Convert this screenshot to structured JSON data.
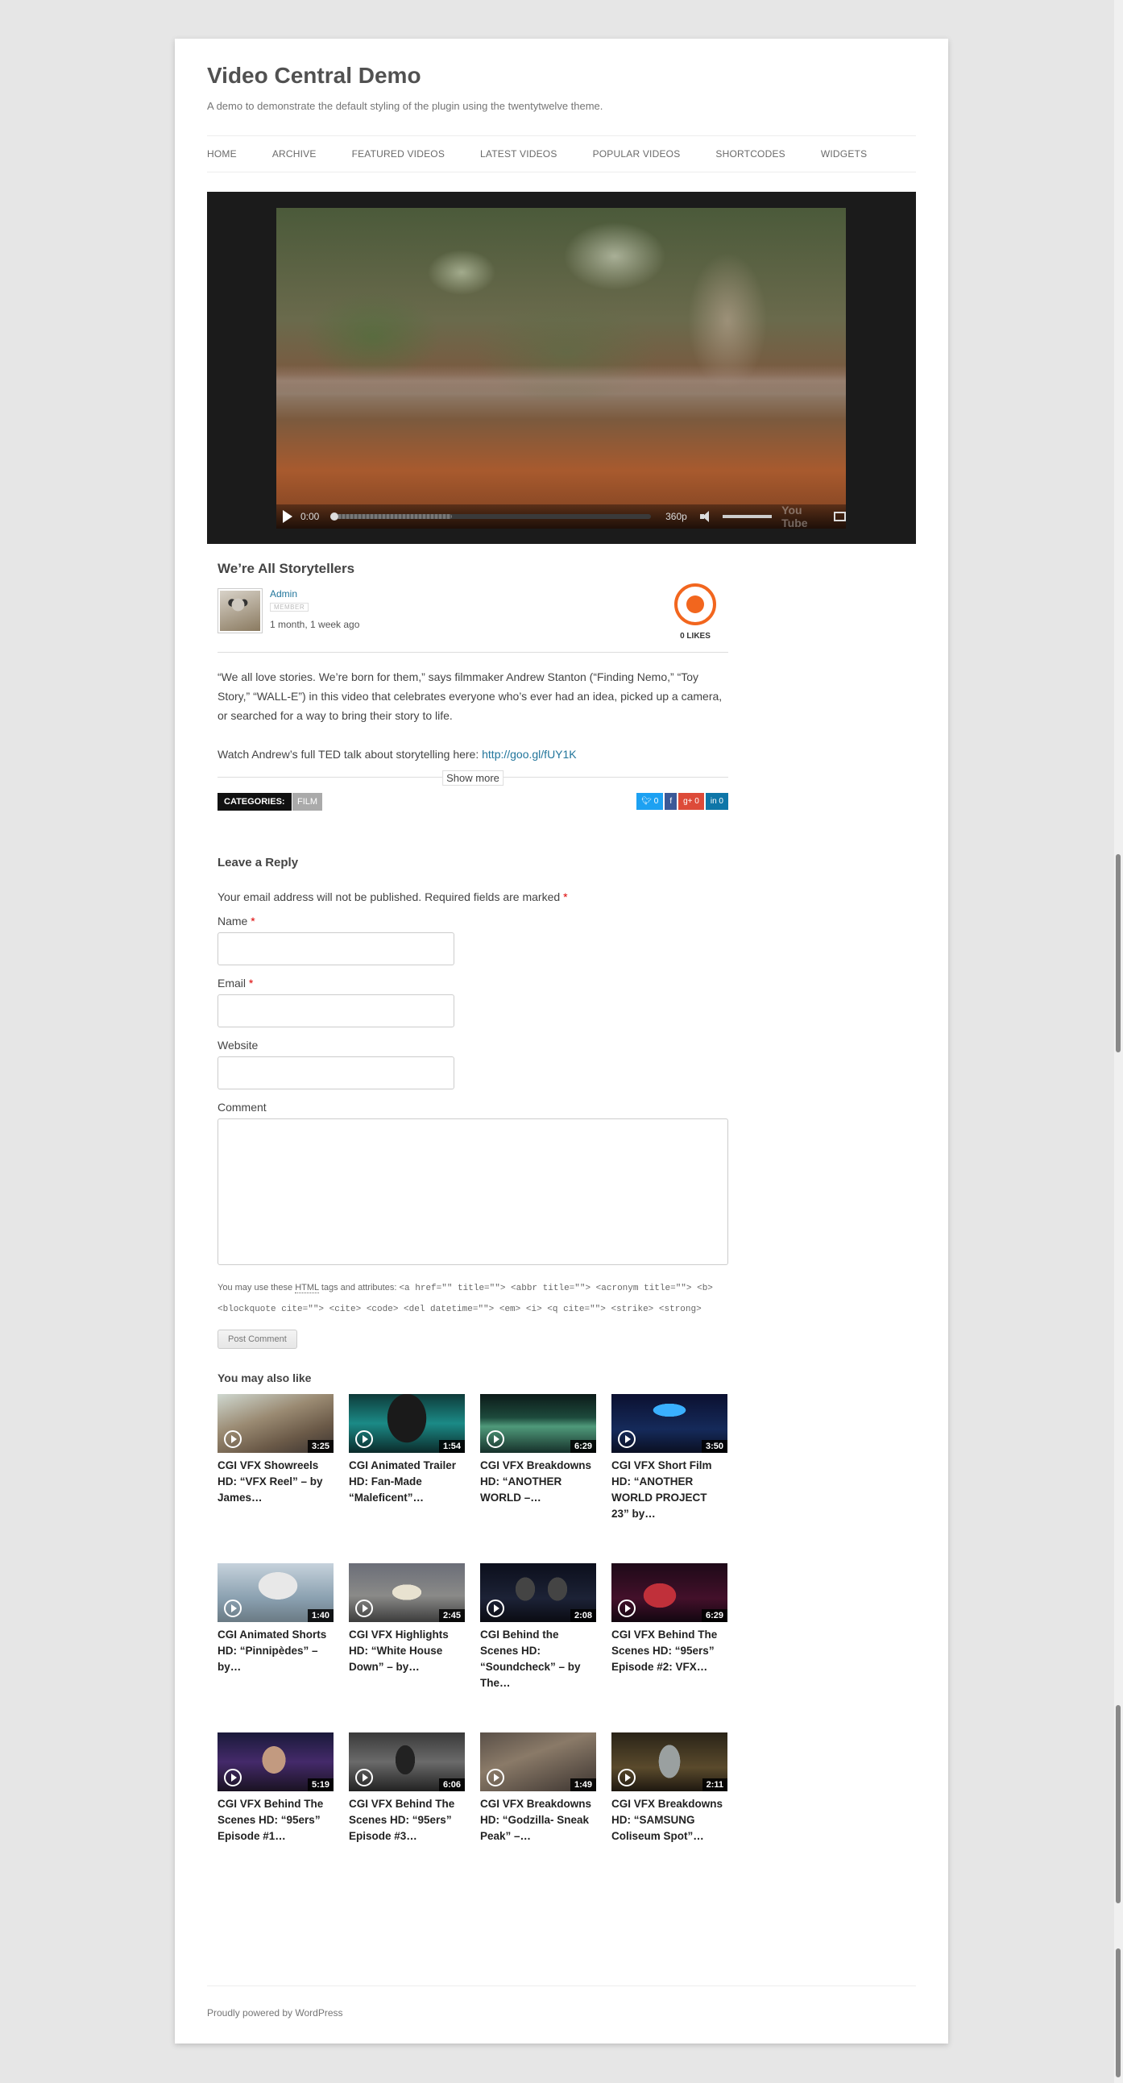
{
  "site": {
    "title": "Video Central Demo",
    "description": "A demo to demonstrate the default styling of the plugin using the twentytwelve theme."
  },
  "nav": {
    "items": [
      "HOME",
      "ARCHIVE",
      "FEATURED VIDEOS",
      "LATEST VIDEOS",
      "POPULAR VIDEOS",
      "SHORTCODES",
      "WIDGETS"
    ]
  },
  "player": {
    "time": "0:00",
    "quality": "360p",
    "watermark": "You Tube"
  },
  "post": {
    "title": "We’re All Storytellers",
    "author": "Admin",
    "author_role": "MEMBER",
    "time_ago": "1 month, 1 week ago",
    "likes": "0 LIKES",
    "paragraph1": "“We all love stories. We’re born for them,” says filmmaker Andrew Stanton (“Finding Nemo,” “Toy Story,” “WALL-E”) in this video that celebrates everyone who’s ever had an idea, picked up a camera, or searched for a way to bring their story to life.",
    "paragraph2_text": "Watch Andrew’s full TED talk about storytelling here: ",
    "paragraph2_link": "http://goo.gl/fUY1K",
    "show_more": "Show more",
    "categories_label": "CATEGORIES:",
    "category": "FILM",
    "share": {
      "twitter": "  0",
      "facebook": "f",
      "google": "g+ 0",
      "linkedin": "in 0"
    }
  },
  "reply": {
    "title": "Leave a Reply",
    "notes": "Your email address will not be published. Required fields are marked ",
    "required_mark": "*",
    "name_label": "Name ",
    "email_label": "Email ",
    "website_label": "Website",
    "comment_label": "Comment",
    "allowed_prefix": "You may use these ",
    "allowed_abbr": "HTML",
    "allowed_middle": " tags and attributes: ",
    "allowed_code": "<a href=\"\" title=\"\"> <abbr title=\"\"> <acronym title=\"\"> <b> <blockquote cite=\"\"> <cite> <code> <del datetime=\"\"> <em> <i> <q cite=\"\"> <strike> <strong>",
    "post_button": "Post Comment"
  },
  "related": {
    "title": "You may also like",
    "items": [
      {
        "title": "CGI VFX Showreels HD: “VFX Reel” – by James…",
        "duration": "3:25"
      },
      {
        "title": "CGI Animated Trailer HD: Fan-Made “Maleficent”…",
        "duration": "1:54"
      },
      {
        "title": "CGI VFX Breakdowns HD: “ANOTHER WORLD –…",
        "duration": "6:29"
      },
      {
        "title": "CGI VFX Short Film HD: “ANOTHER WORLD PROJECT 23” by…",
        "duration": "3:50"
      },
      {
        "title": "CGI Animated Shorts HD: “Pinnipèdes” – by…",
        "duration": "1:40"
      },
      {
        "title": "CGI VFX Highlights HD: “White House Down” – by…",
        "duration": "2:45"
      },
      {
        "title": "CGI Behind the Scenes HD: “Soundcheck” – by The…",
        "duration": "2:08"
      },
      {
        "title": "CGI VFX Behind The Scenes HD: “95ers” Episode #2: VFX…",
        "duration": "6:29"
      },
      {
        "title": "CGI VFX Behind The Scenes HD: “95ers” Episode #1…",
        "duration": "5:19"
      },
      {
        "title": "CGI VFX Behind The Scenes HD: “95ers” Episode #3…",
        "duration": "6:06"
      },
      {
        "title": "CGI VFX Breakdowns HD: “Godzilla- Sneak Peak” –…",
        "duration": "1:49"
      },
      {
        "title": "CGI VFX Breakdowns HD: “SAMSUNG Coliseum Spot”…",
        "duration": "2:11"
      }
    ]
  },
  "footer": {
    "text": "Proudly powered by WordPress"
  },
  "colors": {
    "link": "#21759b",
    "like_orange": "#f2661e",
    "twitter": "#1da1f2",
    "facebook": "#3b5998",
    "google": "#dd4b39",
    "linkedin": "#0e76a8"
  }
}
